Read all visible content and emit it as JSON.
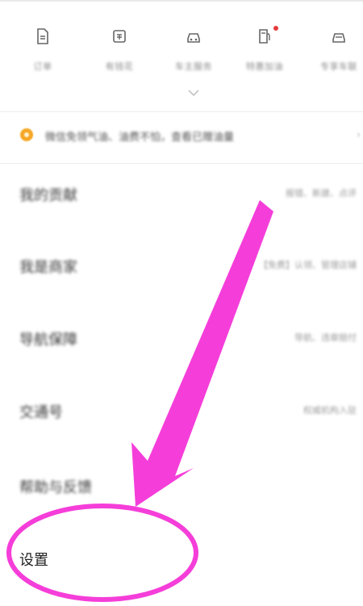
{
  "quick_actions": [
    {
      "label": "订单",
      "icon": "document-icon",
      "has_dot": false
    },
    {
      "label": "有钱花",
      "icon": "wallet-icon",
      "has_dot": false
    },
    {
      "label": "车主服务",
      "icon": "car-service-icon",
      "has_dot": false
    },
    {
      "label": "特惠加油",
      "icon": "fuel-coupon-icon",
      "has_dot": true
    },
    {
      "label": "专享车联",
      "icon": "car-link-icon",
      "has_dot": false
    }
  ],
  "notice": {
    "text": "微信免领气油、油费不怕，查看已赠油量",
    "icon": "fuel-drop-icon"
  },
  "menu": [
    {
      "title": "我的贡献",
      "subtitle": "报错、新建、点评"
    },
    {
      "title": "我是商家",
      "subtitle": "【免费】认领、管理店铺"
    },
    {
      "title": "导航保障",
      "subtitle": "导航、违章赔付"
    },
    {
      "title": "交通号",
      "subtitle": "权威机构入驻"
    },
    {
      "title": "帮助与反馈",
      "subtitle": ""
    },
    {
      "title": "设置",
      "subtitle": ""
    }
  ],
  "colors": {
    "annotation": "#f53ed9",
    "notice_icon": "#f5a623",
    "badge_dot": "#e53a3a"
  }
}
